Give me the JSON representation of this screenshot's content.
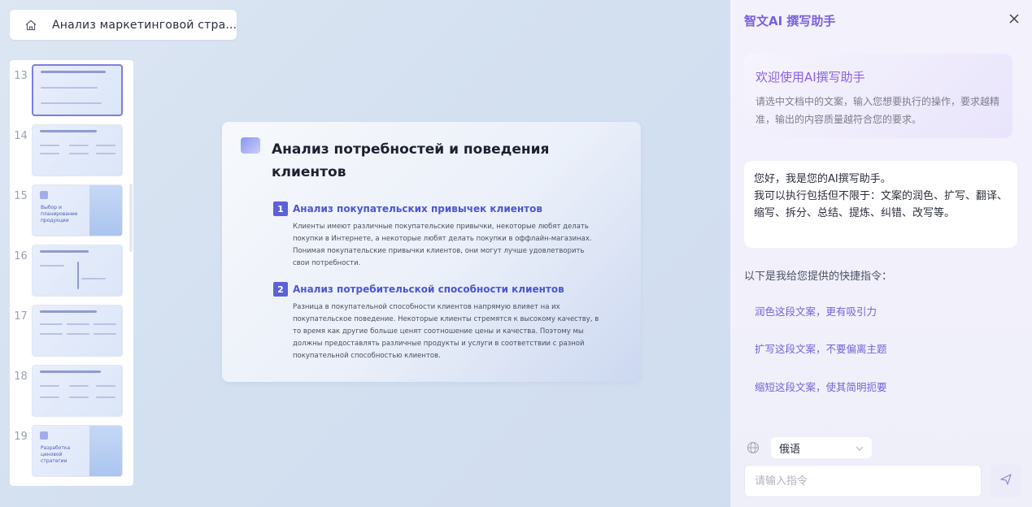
{
  "document": {
    "title": "Анализ маркетинговой стра..."
  },
  "thumbnails": [
    {
      "number": "13",
      "label": "",
      "active": true
    },
    {
      "number": "14",
      "label": "",
      "active": false
    },
    {
      "number": "15",
      "label": "Выбор и планирование продукции",
      "active": false
    },
    {
      "number": "16",
      "label": "",
      "active": false
    },
    {
      "number": "17",
      "label": "",
      "active": false
    },
    {
      "number": "18",
      "label": "",
      "active": false
    },
    {
      "number": "19",
      "label": "Разработка ценовой стратегии",
      "active": false
    }
  ],
  "slide": {
    "title": "Анализ потребностей и поведения клиентов",
    "sections": [
      {
        "num": "1",
        "title": "Анализ покупательских привычек клиентов",
        "body": "Клиенты имеют различные покупательские привычки, некоторые любят делать покупки в Интернете, а некоторые любят делать покупки в оффлайн-магазинах. Понимая покупательские привычки клиентов, они могут лучше удовлетворить свои потребности."
      },
      {
        "num": "2",
        "title": "Анализ потребительской способности клиентов",
        "body": "Разница в покупательной способности клиентов напрямую влияет на их покупательское поведение. Некоторые клиенты стремятся к высокому качеству, в то время как другие больше ценят соотношение цены и качества. Поэтому мы должны предоставлять различные продукты и услуги в соответствии с разной покупательной способностью клиентов."
      }
    ]
  },
  "assistant": {
    "header_title": "智文AI 撰写助手",
    "welcome_title": "欢迎使用AI撰写助手",
    "welcome_desc": "请选中文档中的文案，输入您想要执行的操作，要求越精准，输出的内容质量越符合您的要求。",
    "greeting_line1": "您好，我是您的AI撰写助手。",
    "greeting_line2": "我可以执行包括但不限于：文案的润色、扩写、翻译、缩写、拆分、总结、提炼、纠错、改写等。",
    "shortcuts_label": "以下是我给您提供的快捷指令：",
    "shortcuts": [
      "润色这段文案，更有吸引力",
      "扩写这段文案，不要偏离主题",
      "缩短这段文案，使其简明扼要"
    ],
    "language": "俄语",
    "input_placeholder": "请输入指令"
  },
  "colors": {
    "accent": "#5b61d8",
    "assistant_accent": "#7a5fe0",
    "background": "#d3e0f0"
  }
}
